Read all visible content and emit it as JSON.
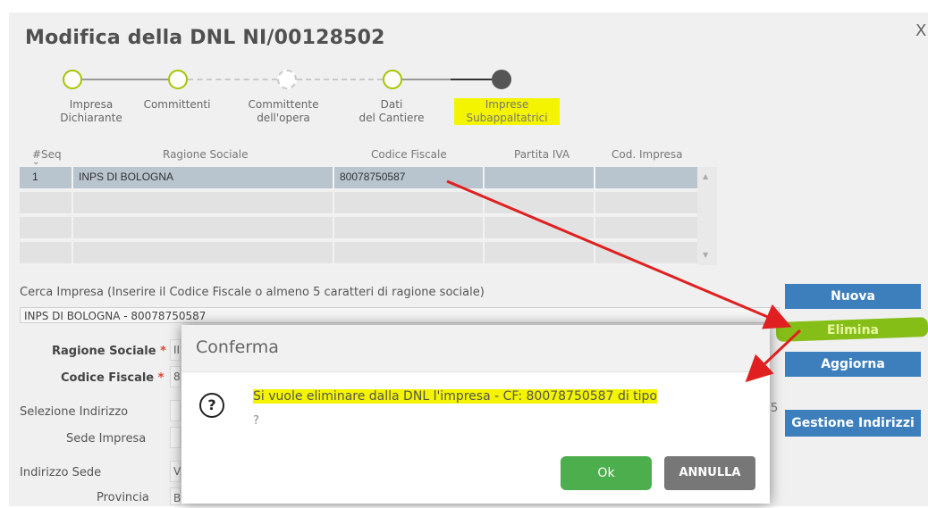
{
  "window": {
    "title": "Modifica della DNL NI/00128502",
    "close_label": "X"
  },
  "steps": [
    {
      "label": "Impresa\nDichiarante"
    },
    {
      "label": "Committenti"
    },
    {
      "label": "Committente\ndell'opera"
    },
    {
      "label": "Dati\ndel Cantiere"
    },
    {
      "label": "Imprese\nSubappaltatrici"
    }
  ],
  "grid": {
    "headers": [
      "#Seq",
      "Ragione Sociale",
      "Codice Fiscale",
      "Partita IVA",
      "Cod. Impresa"
    ],
    "rows": [
      {
        "seq": "1",
        "ragione": "INPS DI BOLOGNA",
        "cf": "80078750587",
        "piva": "",
        "cod": ""
      }
    ]
  },
  "search": {
    "label": "Cerca Impresa (Inserire il Codice Fiscale o almeno 5 caratteri di ragione sociale)",
    "value": "INPS DI BOLOGNA - 80078750587"
  },
  "form": {
    "ragione_label": "Ragione Sociale",
    "ragione_value": "II",
    "cf_label": "Codice Fiscale",
    "cf_value": "8",
    "sel_indirizzo_label": "Selezione Indirizzo",
    "sede_label": "Sede Impresa",
    "indirizzo_label": "Indirizzo Sede",
    "indirizzo_value": "V",
    "provincia_label": "Provincia",
    "provincia_value": "B",
    "required_mark": "*",
    "partial_right": "5"
  },
  "side_buttons": {
    "nuova": "Nuova",
    "elimina": "Elimina",
    "aggiorna": "Aggiorna",
    "gestione": "Gestione Indirizzi"
  },
  "dialog": {
    "title": "Conferma",
    "icon": "?",
    "message": "Si vuole eliminare dalla DNL l'impresa - CF: 80078750587 di tipo",
    "message2": "?",
    "ok": "Ok",
    "annulla": "ANNULLA"
  },
  "colors": {
    "accent_blue": "#3d7fbd",
    "green": "#4cae4c",
    "highlight": "#f4f400",
    "arrow": "#e02020"
  }
}
